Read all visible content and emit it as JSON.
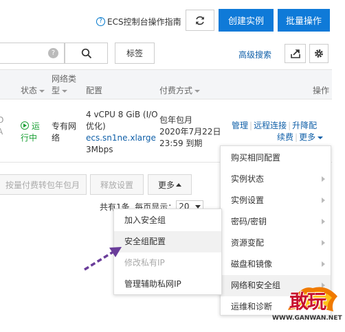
{
  "topbar": {
    "guide_label": "ECS控制台操作指南",
    "create_instance": "创建实例",
    "batch_ops": "批量操作"
  },
  "search": {
    "help_glyph": "?",
    "tag_label": "标签",
    "advanced_search": "高级搜索"
  },
  "table": {
    "headers": {
      "status": "状态",
      "network_line1": "网络类",
      "network_line2": "型",
      "config": "配置",
      "billing": "付费方式",
      "actions": "操作"
    },
    "row": {
      "left_partial_1": "O",
      "left_partial_2": "A",
      "status_line1": "运",
      "status_line2": "行中",
      "network_line1": "专有网",
      "network_line2": "络",
      "config_line1": "4 vCPU 8 GiB (I/O",
      "config_line2": "优化)",
      "config_type": "ecs.sn1ne.xlarge",
      "config_bandwidth": "3Mbps",
      "billing_line1": "包年包月",
      "billing_line2": "2020年7月22日",
      "billing_line3": "23:59 到期",
      "action_manage": "管理",
      "action_remote": "远程连接",
      "action_upgrade": "升降配",
      "action_renew": "续费",
      "action_more": "更多"
    }
  },
  "bottom_bar": {
    "convert_label": "按量付费转包年包月",
    "release_label": "释放设置",
    "more_label": "更多",
    "pagination_prefix": "共有1条, 每页显示：",
    "page_size": "20"
  },
  "more_menu": {
    "items": [
      "购买相同配置",
      "实例状态",
      "实例设置",
      "密码/密钥",
      "资源变配",
      "磁盘和镜像",
      "网络和安全组",
      "运维和诊断"
    ]
  },
  "network_submenu": {
    "items": [
      "加入安全组",
      "安全组配置",
      "修改私有IP",
      "管理辅助私网IP"
    ]
  },
  "watermark": {
    "logo_text": "敢玩",
    "url": "WWW.GANWAN.NET"
  },
  "colors": {
    "primary_blue": "#0f7ad8",
    "link_blue": "#0f5fa8",
    "running_green": "#1aa035",
    "arrow_purple": "#6a3d9a"
  }
}
